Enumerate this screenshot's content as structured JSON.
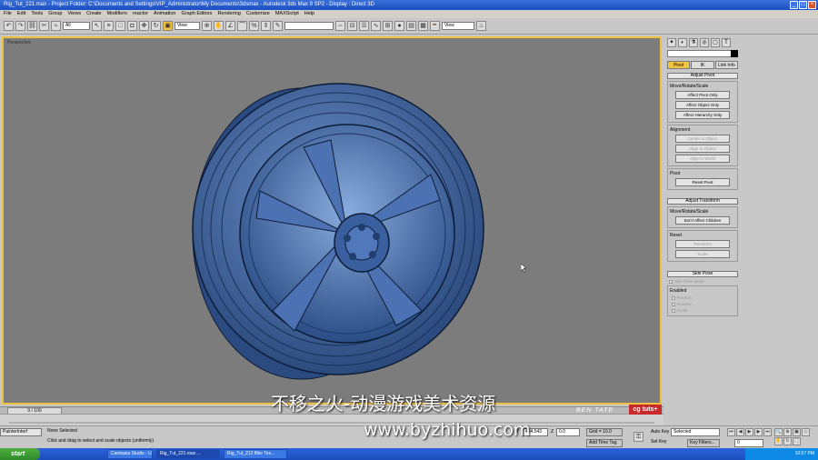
{
  "window": {
    "title": "Rig_Tut_221.max  -  Project Folder: C:\\Documents and Settings\\VIP_Administrator\\My Documents\\3dsmax  -  Autodesk 3ds Max 9 SP2  -  Display : Direct 3D"
  },
  "menu": [
    "File",
    "Edit",
    "Tools",
    "Group",
    "Views",
    "Create",
    "Modifiers",
    "reactor",
    "Animation",
    "Graph Editors",
    "Rendering",
    "Customize",
    "MAXScript",
    "Help"
  ],
  "toolbar": {
    "selection_filter": "All",
    "ref_coord": "View",
    "named_selection": "",
    "view_dropdown": "View"
  },
  "viewport": {
    "label": "Perspective"
  },
  "command_panel": {
    "tabs": [
      "Pivot",
      "IK",
      "Link Info"
    ],
    "active_tab": "Pivot",
    "adjust_pivot": {
      "header": "Adjust Pivot",
      "move_group": "Move/Rotate/Scale",
      "buttons": [
        "Affect Pivot Only",
        "Affect Object Only",
        "Affect Hierarchy Only"
      ],
      "alignment_group": "Alignment",
      "alignment_buttons": [
        "Center to Object",
        "Align to Object",
        "Align to World"
      ],
      "pivot_group": "Pivot",
      "pivot_button": "Reset Pivot"
    },
    "adjust_transform": {
      "header": "Adjust Transform",
      "move_group": "Move/Rotate/Scale",
      "button": "Don't Affect Children",
      "reset_group": "Reset",
      "reset_buttons": [
        "Transform",
        "Scale"
      ]
    },
    "skin_pose": {
      "header": "Skin Pose",
      "mode_label": "Skin Pose Mode",
      "enabled_group": "Enabled",
      "options": [
        "Position",
        "Rotation",
        "Scale"
      ]
    }
  },
  "timeline": {
    "frame": "0 / 100"
  },
  "status": {
    "selection": "None Selected",
    "prompt": "Click and drag to select and scale objects (uniformly)",
    "y_label": "Y",
    "y_value": "404.543",
    "z_label": "Z",
    "z_value": "0.0",
    "grid": "Grid = 10.0",
    "add_time_tag": "Add Time Tag",
    "auto_key": "Auto Key",
    "set_key": "Set Key",
    "selected_dropdown": "Selected",
    "key_filters": "Key Filters...",
    "frame_field": "0",
    "painter": "PainterInterf"
  },
  "taskbar": {
    "start": "start",
    "tasks": [
      "Camtasia Studio - Unt...",
      "Rig_Tut_221.max ...",
      "Rig_Tut_212 filler Tex..."
    ],
    "clock": "10:57 PM"
  },
  "overlay": {
    "watermark_title": "不移之火-动漫游戏美术资源",
    "watermark_url": "www.byzhihuo.com",
    "credit": "BEN TATE",
    "logo": "cg tuts+"
  },
  "colors": {
    "viewport_bg": "#7c7c7c",
    "active_border": "#f0c040",
    "wheel": "#3f6aa8",
    "taskbar": "#1c4dbb",
    "start": "#2f8a2a"
  }
}
